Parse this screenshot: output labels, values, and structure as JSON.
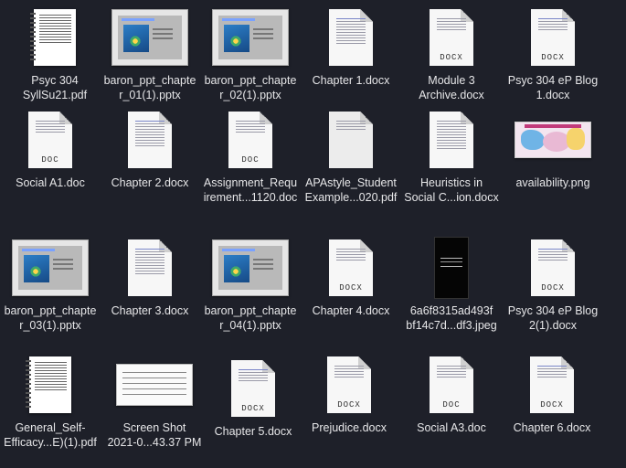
{
  "files": [
    {
      "name": "Psyc 304\nSyllSu21.pdf",
      "kind": "pdf"
    },
    {
      "name": "baron_ppt_chapte\nr_01(1).pptx",
      "kind": "pptx"
    },
    {
      "name": "baron_ppt_chapte\nr_02(1).pptx",
      "kind": "pptx"
    },
    {
      "name": "Chapter 1.docx",
      "kind": "docx"
    },
    {
      "name": "Module 3\nArchive.docx",
      "kind": "docx",
      "tag": "DOCX"
    },
    {
      "name": "Psyc 304 eP Blog\n1.docx",
      "kind": "docx",
      "tag": "DOCX"
    },
    {
      "name": "Social A1.doc",
      "kind": "doc",
      "tag": "DOC"
    },
    {
      "name": "Chapter 2.docx",
      "kind": "docx"
    },
    {
      "name": "Assignment_Requ\nirement...1120.doc",
      "kind": "doc",
      "tag": "DOC"
    },
    {
      "name": "APAstyle_Student\nExample...020.pdf",
      "kind": "docx"
    },
    {
      "name": "Heuristics in\nSocial C...ion.docx",
      "kind": "docx"
    },
    {
      "name": "availability.png",
      "kind": "png"
    },
    {
      "name": "baron_ppt_chapte\nr_03(1).pptx",
      "kind": "pptx"
    },
    {
      "name": "Chapter 3.docx",
      "kind": "docx"
    },
    {
      "name": "baron_ppt_chapte\nr_04(1).pptx",
      "kind": "pptx"
    },
    {
      "name": "Chapter 4.docx",
      "kind": "docx",
      "tag": "DOCX"
    },
    {
      "name": "6a6f8315ad493f\nbf14c7d...df3.jpeg",
      "kind": "jpeg"
    },
    {
      "name": "Psyc 304 eP Blog\n2(1).docx",
      "kind": "docx",
      "tag": "DOCX"
    },
    {
      "name": "General_Self-\nEfficacy...E)(1).pdf",
      "kind": "pdf"
    },
    {
      "name": "Screen Shot\n2021-0...43.37 PM",
      "kind": "shot"
    },
    {
      "name": "Chapter 5.docx",
      "kind": "docx",
      "tag": "DOCX"
    },
    {
      "name": "Prejudice.docx",
      "kind": "docx",
      "tag": "DOCX"
    },
    {
      "name": "Social A3.doc",
      "kind": "doc",
      "tag": "DOC"
    },
    {
      "name": "Chapter 6.docx",
      "kind": "docx",
      "tag": "DOCX"
    }
  ]
}
